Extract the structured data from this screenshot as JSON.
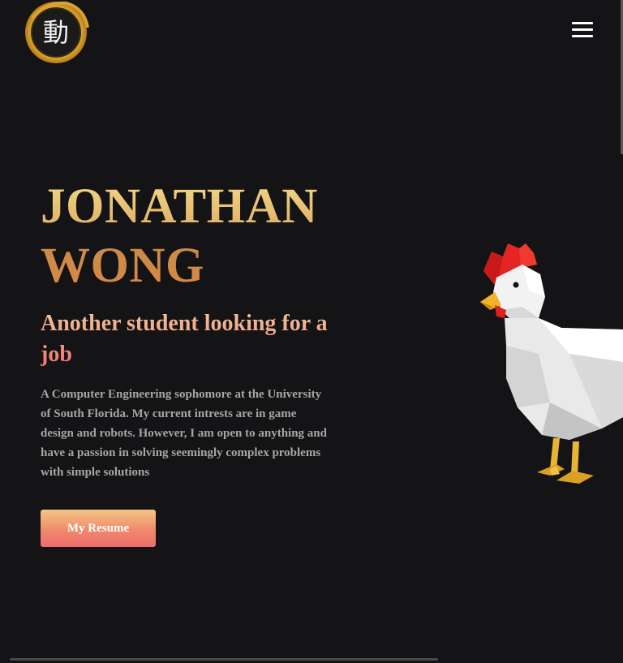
{
  "header": {
    "logo": {
      "icon": "kanji-seal-logo",
      "text": "動"
    },
    "menu": {
      "icon": "hamburger-menu-icon"
    }
  },
  "hero": {
    "name_line1": "JONATHAN",
    "name_line2": "WONG",
    "tagline": "Another student looking for a job",
    "bio": "A Computer Engineering sophomore at the University of South Florida. My current intrests are in game design and robots. However, I am open to anything and have a passion in solving seemingly complex problems with simple solutions",
    "resume_label": "My Resume"
  },
  "illustration": {
    "icon": "low-poly-chicken"
  },
  "colors": {
    "background": "#141315",
    "name_gradient": [
      "#f3da8a",
      "#cc8a4a"
    ],
    "tagline_gradient": [
      "#f2c79a",
      "#ea6f6f"
    ],
    "button_gradient": [
      "#f4c684",
      "#ec6b6b"
    ],
    "bio_text": "#a6a6a6"
  }
}
